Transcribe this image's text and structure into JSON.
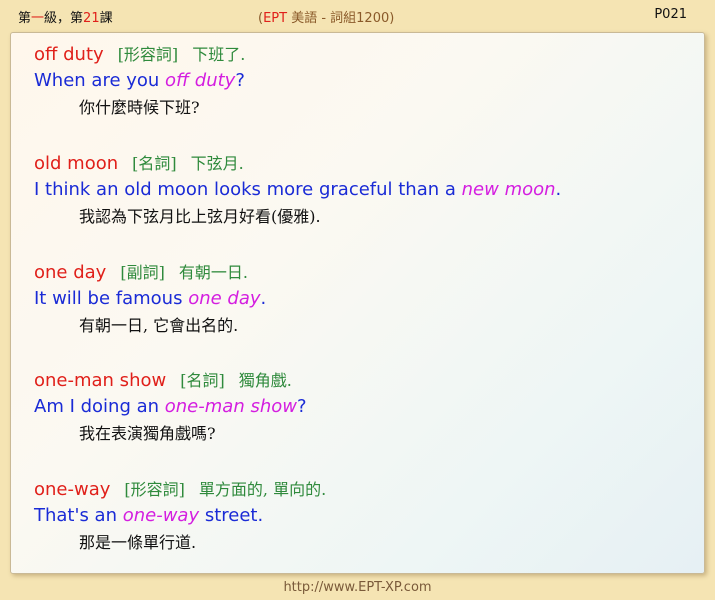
{
  "header": {
    "lesson_prefix": "第",
    "lesson_level": "一",
    "lesson_mid": "級，第",
    "lesson_num": "21",
    "lesson_suffix": "課",
    "title_open": "(",
    "title_ept": "EPT",
    "title_rest": " 美語 - 詞組1200)",
    "page": "P021"
  },
  "entries": [
    {
      "term": "off duty",
      "pos": "[形容詞]",
      "definition": "下班了.",
      "example_before": "When are you ",
      "example_highlight": "off duty",
      "example_after": "?",
      "translation": "你什麼時候下班?"
    },
    {
      "term": "old moon",
      "pos": "[名詞]",
      "definition": "下弦月.",
      "example_before": "I think an old moon looks more graceful than a ",
      "example_highlight": "new moon",
      "example_after": ".",
      "translation": "我認為下弦月比上弦月好看(優雅)."
    },
    {
      "term": "one day",
      "pos": "[副詞]",
      "definition": "有朝一日.",
      "example_before": "It will be famous ",
      "example_highlight": "one day",
      "example_after": ".",
      "translation": "有朝一日, 它會出名的."
    },
    {
      "term": "one-man show",
      "pos": "[名詞]",
      "definition": "獨角戲.",
      "example_before": "Am I doing an ",
      "example_highlight": "one-man show",
      "example_after": "?",
      "translation": "我在表演獨角戲嗎?"
    },
    {
      "term": "one-way",
      "pos": "[形容詞]",
      "definition": "單方面的, 單向的.",
      "example_before": "That's an ",
      "example_highlight": "one-way",
      "example_after": " street.",
      "translation": "那是一條單行道."
    }
  ],
  "footer": {
    "url": "http://www.EPT-XP.com"
  }
}
